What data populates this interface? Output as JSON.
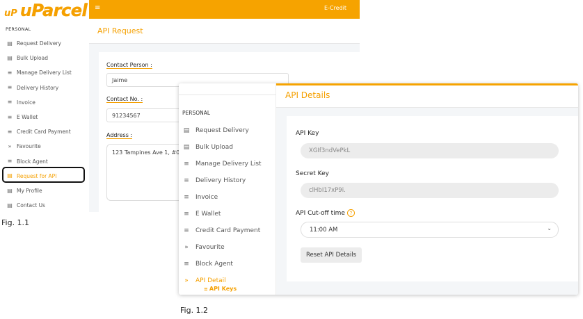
{
  "fig1": {
    "logo_small": "uP",
    "logo_u": "u",
    "logo_rest": "Parcel",
    "section": "PERSONAL",
    "nav": [
      {
        "label": "Request Delivery",
        "icon": "form-icon"
      },
      {
        "label": "Bulk Upload",
        "icon": "form-icon"
      },
      {
        "label": "Manage Delivery List",
        "icon": "list-icon"
      },
      {
        "label": "Delivery History",
        "icon": "list-icon"
      },
      {
        "label": "Invoice",
        "icon": "list-icon"
      },
      {
        "label": "E Wallet",
        "icon": "list-icon"
      },
      {
        "label": "Credit Card Payment",
        "icon": "list-icon"
      },
      {
        "label": "Favourite",
        "icon": "double-chevron-icon"
      },
      {
        "label": "Block Agent",
        "icon": "list-icon"
      },
      {
        "label": "Request for API",
        "icon": "form-icon"
      },
      {
        "label": "My Profile",
        "icon": "form-icon"
      },
      {
        "label": "Contact Us",
        "icon": "form-icon"
      }
    ],
    "topbar_text": "E-Credit",
    "page_title": "API Request",
    "form": {
      "contact_person_label": "Contact Person :",
      "contact_person_value": "Jaime",
      "contact_no_label": "Contact No. :",
      "contact_no_value": "91234567",
      "address_label": "Address :",
      "address_value": "123 Tampines Ave 1, #0"
    },
    "caption": "Fig. 1.1"
  },
  "fig2": {
    "section": "PERSONAL",
    "nav": [
      {
        "label": "Request Delivery",
        "icon": "form-icon"
      },
      {
        "label": "Bulk Upload",
        "icon": "form-icon"
      },
      {
        "label": "Manage Delivery List",
        "icon": "list-icon"
      },
      {
        "label": "Delivery History",
        "icon": "list-icon"
      },
      {
        "label": "Invoice",
        "icon": "list-icon"
      },
      {
        "label": "E Wallet",
        "icon": "list-icon"
      },
      {
        "label": "Credit Card Payment",
        "icon": "list-icon"
      },
      {
        "label": "Favourite",
        "icon": "double-chevron-icon"
      },
      {
        "label": "Block Agent",
        "icon": "list-icon"
      },
      {
        "label": "API Detail",
        "icon": "double-chevron-icon"
      }
    ],
    "sub_item": "API Keys",
    "page_title": "API Details",
    "api_key_label": "API Key",
    "api_key_value": "XGIf3ndVePkL",
    "secret_key_label": "Secret Key",
    "secret_key_value": "clHbI17xP9i.",
    "cutoff_label": "API Cut-off time",
    "cutoff_value": "11:00 AM",
    "reset_button": "Reset API Details",
    "caption": "Fig. 1.2"
  },
  "colors": {
    "accent": "#f6a300",
    "bg": "#f4f6f8"
  }
}
